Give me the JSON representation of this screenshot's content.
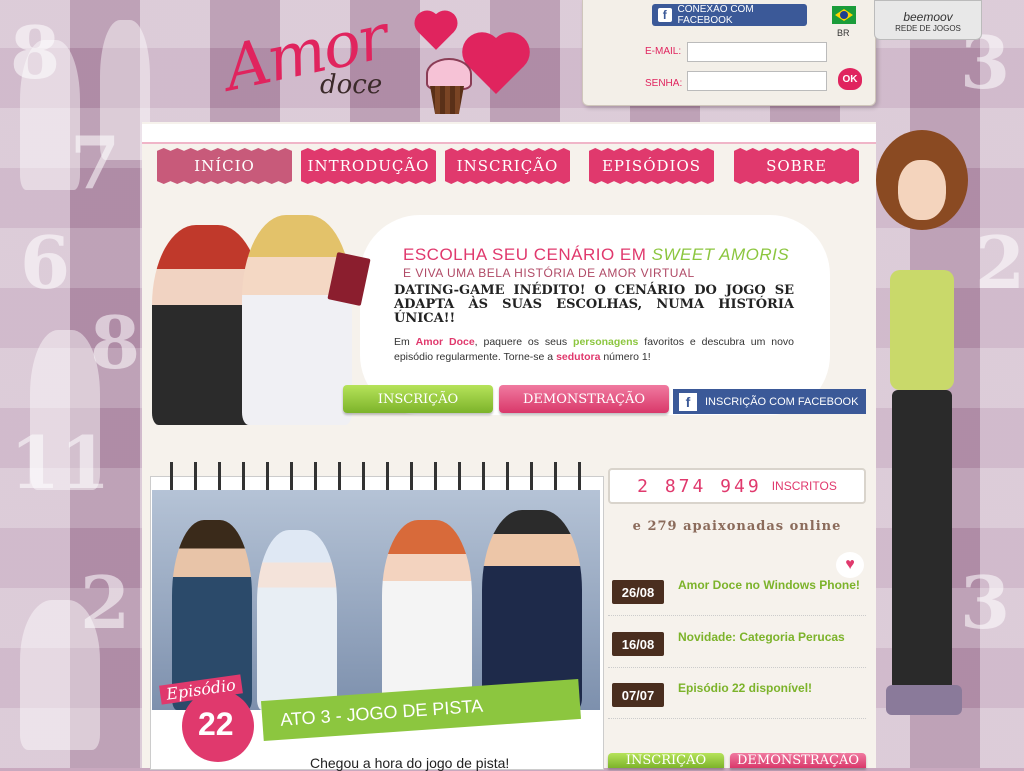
{
  "header": {
    "logo": {
      "word1": "Amor",
      "word2": "doce"
    },
    "facebook_connect": "CONEXÃO COM FACEBOOK",
    "country": "BR",
    "email_label": "E-MAIL:",
    "password_label": "SENHA:",
    "email_value": "",
    "password_value": "",
    "ok_label": "OK",
    "network": {
      "brand": "beemoov",
      "label": "REDE DE JOGOS"
    }
  },
  "nav": {
    "tabs": [
      {
        "label": "INÍCIO"
      },
      {
        "label": "INTRODUÇÃO"
      },
      {
        "label": "INSCRIÇÃO"
      },
      {
        "label": "EPISÓDIOS"
      },
      {
        "label": "SOBRE"
      }
    ]
  },
  "hero": {
    "headline_prefix": "ESCOLHA SEU CENÁRIO EM",
    "headline_emphasis": "SWEET AMORIS",
    "subheadline": "E VIVA UMA BELA HISTÓRIA DE AMOR VIRTUAL",
    "tagline": "DATING-GAME INÉDITO! O CENÁRIO DO JOGO SE ADAPTA ÀS SUAS ESCOLHAS, NUMA HISTÓRIA ÚNICA!!",
    "desc": {
      "p1": "Em",
      "brand": "Amor Doce",
      "p2": ", paquere os seus",
      "characters": "personagens",
      "p3": "favoritos e descubra um novo episódio regularmente. Torne-se a",
      "role": "sedutora",
      "p4": "número 1!"
    },
    "signup_button": "INSCRIÇÃO",
    "demo_button": "DEMONSTRAÇÃO",
    "facebook_signup": "INSCRIÇÃO COM FACEBOOK"
  },
  "episode": {
    "label": "Episódio",
    "number": "22",
    "title": "ATO 3 - JOGO DE PISTA",
    "text": "Chegou a hora do jogo de pista!"
  },
  "stats": {
    "subscribers": "2 874 949",
    "subscribers_label": "INSCRITOS",
    "online": "e 279 apaixonadas online"
  },
  "news": [
    {
      "date": "26/08",
      "title": "Amor Doce no Windows Phone!"
    },
    {
      "date": "16/08",
      "title": "Novidade: Categoria Perucas"
    },
    {
      "date": "07/07",
      "title": "Episódio 22 disponível!"
    }
  ],
  "bottom_buttons": {
    "signup": "INSCRIÇÃO",
    "demo": "DEMONSTRAÇÃO"
  },
  "colors": {
    "pink": "#e0396d",
    "green": "#8cc63f",
    "facebook": "#3b5998",
    "brown": "#4a2e1f"
  }
}
